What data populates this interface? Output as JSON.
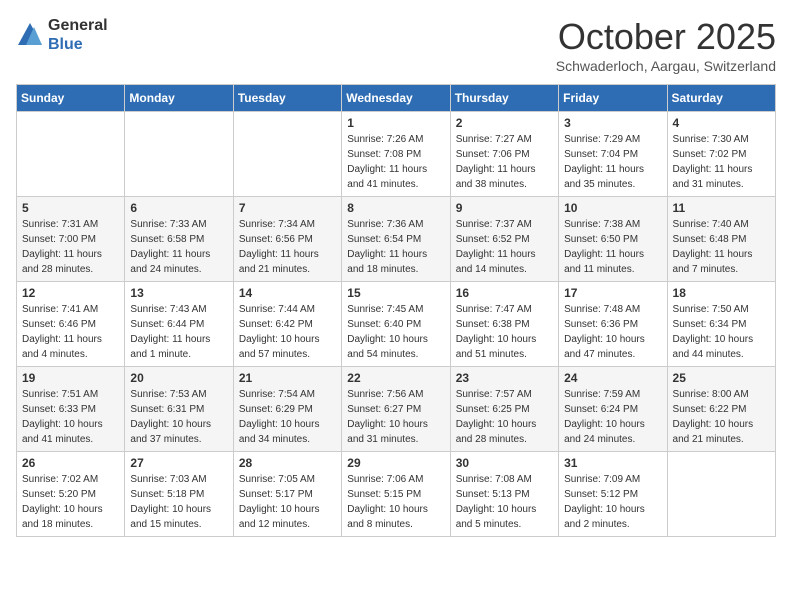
{
  "header": {
    "logo_general": "General",
    "logo_blue": "Blue",
    "month": "October 2025",
    "location": "Schwaderloch, Aargau, Switzerland"
  },
  "days_of_week": [
    "Sunday",
    "Monday",
    "Tuesday",
    "Wednesday",
    "Thursday",
    "Friday",
    "Saturday"
  ],
  "weeks": [
    [
      {
        "day": "",
        "sunrise": "",
        "sunset": "",
        "daylight": ""
      },
      {
        "day": "",
        "sunrise": "",
        "sunset": "",
        "daylight": ""
      },
      {
        "day": "",
        "sunrise": "",
        "sunset": "",
        "daylight": ""
      },
      {
        "day": "1",
        "sunrise": "Sunrise: 7:26 AM",
        "sunset": "Sunset: 7:08 PM",
        "daylight": "Daylight: 11 hours and 41 minutes."
      },
      {
        "day": "2",
        "sunrise": "Sunrise: 7:27 AM",
        "sunset": "Sunset: 7:06 PM",
        "daylight": "Daylight: 11 hours and 38 minutes."
      },
      {
        "day": "3",
        "sunrise": "Sunrise: 7:29 AM",
        "sunset": "Sunset: 7:04 PM",
        "daylight": "Daylight: 11 hours and 35 minutes."
      },
      {
        "day": "4",
        "sunrise": "Sunrise: 7:30 AM",
        "sunset": "Sunset: 7:02 PM",
        "daylight": "Daylight: 11 hours and 31 minutes."
      }
    ],
    [
      {
        "day": "5",
        "sunrise": "Sunrise: 7:31 AM",
        "sunset": "Sunset: 7:00 PM",
        "daylight": "Daylight: 11 hours and 28 minutes."
      },
      {
        "day": "6",
        "sunrise": "Sunrise: 7:33 AM",
        "sunset": "Sunset: 6:58 PM",
        "daylight": "Daylight: 11 hours and 24 minutes."
      },
      {
        "day": "7",
        "sunrise": "Sunrise: 7:34 AM",
        "sunset": "Sunset: 6:56 PM",
        "daylight": "Daylight: 11 hours and 21 minutes."
      },
      {
        "day": "8",
        "sunrise": "Sunrise: 7:36 AM",
        "sunset": "Sunset: 6:54 PM",
        "daylight": "Daylight: 11 hours and 18 minutes."
      },
      {
        "day": "9",
        "sunrise": "Sunrise: 7:37 AM",
        "sunset": "Sunset: 6:52 PM",
        "daylight": "Daylight: 11 hours and 14 minutes."
      },
      {
        "day": "10",
        "sunrise": "Sunrise: 7:38 AM",
        "sunset": "Sunset: 6:50 PM",
        "daylight": "Daylight: 11 hours and 11 minutes."
      },
      {
        "day": "11",
        "sunrise": "Sunrise: 7:40 AM",
        "sunset": "Sunset: 6:48 PM",
        "daylight": "Daylight: 11 hours and 7 minutes."
      }
    ],
    [
      {
        "day": "12",
        "sunrise": "Sunrise: 7:41 AM",
        "sunset": "Sunset: 6:46 PM",
        "daylight": "Daylight: 11 hours and 4 minutes."
      },
      {
        "day": "13",
        "sunrise": "Sunrise: 7:43 AM",
        "sunset": "Sunset: 6:44 PM",
        "daylight": "Daylight: 11 hours and 1 minute."
      },
      {
        "day": "14",
        "sunrise": "Sunrise: 7:44 AM",
        "sunset": "Sunset: 6:42 PM",
        "daylight": "Daylight: 10 hours and 57 minutes."
      },
      {
        "day": "15",
        "sunrise": "Sunrise: 7:45 AM",
        "sunset": "Sunset: 6:40 PM",
        "daylight": "Daylight: 10 hours and 54 minutes."
      },
      {
        "day": "16",
        "sunrise": "Sunrise: 7:47 AM",
        "sunset": "Sunset: 6:38 PM",
        "daylight": "Daylight: 10 hours and 51 minutes."
      },
      {
        "day": "17",
        "sunrise": "Sunrise: 7:48 AM",
        "sunset": "Sunset: 6:36 PM",
        "daylight": "Daylight: 10 hours and 47 minutes."
      },
      {
        "day": "18",
        "sunrise": "Sunrise: 7:50 AM",
        "sunset": "Sunset: 6:34 PM",
        "daylight": "Daylight: 10 hours and 44 minutes."
      }
    ],
    [
      {
        "day": "19",
        "sunrise": "Sunrise: 7:51 AM",
        "sunset": "Sunset: 6:33 PM",
        "daylight": "Daylight: 10 hours and 41 minutes."
      },
      {
        "day": "20",
        "sunrise": "Sunrise: 7:53 AM",
        "sunset": "Sunset: 6:31 PM",
        "daylight": "Daylight: 10 hours and 37 minutes."
      },
      {
        "day": "21",
        "sunrise": "Sunrise: 7:54 AM",
        "sunset": "Sunset: 6:29 PM",
        "daylight": "Daylight: 10 hours and 34 minutes."
      },
      {
        "day": "22",
        "sunrise": "Sunrise: 7:56 AM",
        "sunset": "Sunset: 6:27 PM",
        "daylight": "Daylight: 10 hours and 31 minutes."
      },
      {
        "day": "23",
        "sunrise": "Sunrise: 7:57 AM",
        "sunset": "Sunset: 6:25 PM",
        "daylight": "Daylight: 10 hours and 28 minutes."
      },
      {
        "day": "24",
        "sunrise": "Sunrise: 7:59 AM",
        "sunset": "Sunset: 6:24 PM",
        "daylight": "Daylight: 10 hours and 24 minutes."
      },
      {
        "day": "25",
        "sunrise": "Sunrise: 8:00 AM",
        "sunset": "Sunset: 6:22 PM",
        "daylight": "Daylight: 10 hours and 21 minutes."
      }
    ],
    [
      {
        "day": "26",
        "sunrise": "Sunrise: 7:02 AM",
        "sunset": "Sunset: 5:20 PM",
        "daylight": "Daylight: 10 hours and 18 minutes."
      },
      {
        "day": "27",
        "sunrise": "Sunrise: 7:03 AM",
        "sunset": "Sunset: 5:18 PM",
        "daylight": "Daylight: 10 hours and 15 minutes."
      },
      {
        "day": "28",
        "sunrise": "Sunrise: 7:05 AM",
        "sunset": "Sunset: 5:17 PM",
        "daylight": "Daylight: 10 hours and 12 minutes."
      },
      {
        "day": "29",
        "sunrise": "Sunrise: 7:06 AM",
        "sunset": "Sunset: 5:15 PM",
        "daylight": "Daylight: 10 hours and 8 minutes."
      },
      {
        "day": "30",
        "sunrise": "Sunrise: 7:08 AM",
        "sunset": "Sunset: 5:13 PM",
        "daylight": "Daylight: 10 hours and 5 minutes."
      },
      {
        "day": "31",
        "sunrise": "Sunrise: 7:09 AM",
        "sunset": "Sunset: 5:12 PM",
        "daylight": "Daylight: 10 hours and 2 minutes."
      },
      {
        "day": "",
        "sunrise": "",
        "sunset": "",
        "daylight": ""
      }
    ]
  ]
}
